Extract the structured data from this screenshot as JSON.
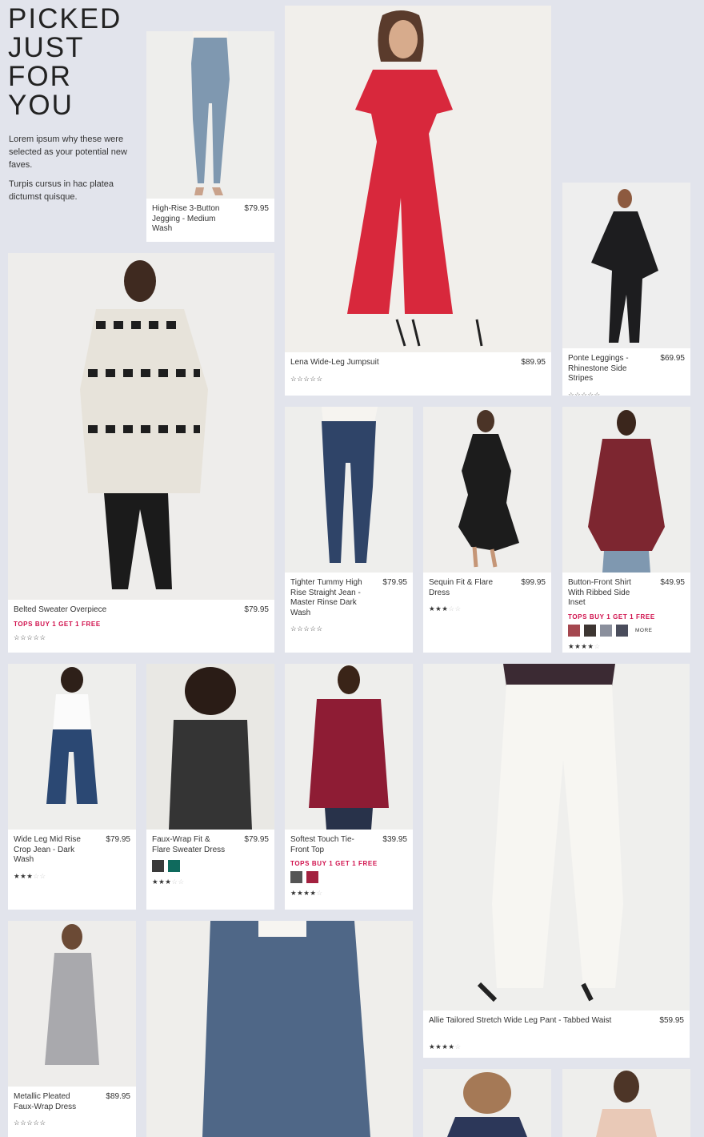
{
  "hero": {
    "title": "PICKED JUST FOR YOU",
    "intro1": "Lorem ipsum why these were selected as your potential new faves.",
    "intro2": "Turpis cursus in hac platea dictumst quisque."
  },
  "products": [
    {
      "name": "High-Rise 3-Button Jegging - Medium Wash",
      "price": "$79.95",
      "stars": 0,
      "promo": "",
      "swatches": []
    },
    {
      "name": "Lena Wide-Leg Jumpsuit",
      "price": "$89.95",
      "stars": 0,
      "promo": "",
      "swatches": []
    },
    {
      "name": "Ponte Leggings - Rhinestone Side Stripes",
      "price": "$69.95",
      "stars": 0,
      "promo": "",
      "swatches": []
    },
    {
      "name": "Belted Sweater Overpiece",
      "price": "$79.95",
      "stars": 0,
      "promo": "TOPS BUY 1 GET 1 FREE",
      "swatches": []
    },
    {
      "name": "Tighter Tummy High Rise Straight Jean - Master Rinse Dark Wash",
      "price": "$79.95",
      "stars": 0,
      "promo": "",
      "swatches": []
    },
    {
      "name": "Sequin Fit & Flare Dress",
      "price": "$99.95",
      "stars": 3,
      "promo": "",
      "swatches": []
    },
    {
      "name": "Button-Front Shirt With Ribbed Side Inset",
      "price": "$49.95",
      "stars": 4,
      "promo": "TOPS BUY 1 GET 1 FREE",
      "swatches": [
        "#a4474f",
        "#3d3632",
        "#8a8f9c",
        "#4a4d5c"
      ],
      "more": "MORE"
    },
    {
      "name": "Wide Leg Mid Rise Crop Jean - Dark Wash",
      "price": "$79.95",
      "stars": 3,
      "promo": "",
      "swatches": []
    },
    {
      "name": "Faux-Wrap Fit & Flare Sweater Dress",
      "price": "$79.95",
      "stars": 3,
      "promo": "",
      "swatches": [
        "#3a3a3a",
        "#0f6a5d"
      ]
    },
    {
      "name": "Softest Touch Tie-Front Top",
      "price": "$39.95",
      "stars": 4,
      "promo": "TOPS BUY 1 GET 1 FREE",
      "swatches": [
        "#555555",
        "#a3213f"
      ]
    },
    {
      "name": "Allie Tailored Stretch Wide Leg Pant - Tabbed Waist",
      "price": "$59.95",
      "stars": 4,
      "promo": "",
      "swatches": []
    },
    {
      "name": "Metallic Pleated Faux-Wrap Dress",
      "price": "$89.95",
      "stars": 0,
      "promo": "",
      "swatches": []
    },
    {
      "name": "",
      "price": "",
      "stars": 0,
      "promo": "",
      "swatches": []
    },
    {
      "name": "",
      "price": "",
      "stars": 0,
      "promo": "",
      "swatches": []
    },
    {
      "name": "",
      "price": "",
      "stars": 0,
      "promo": "",
      "swatches": []
    }
  ],
  "icons": {
    "rating": "star-icon",
    "star_glyph": "☆",
    "star_filled_glyph": "★"
  },
  "colors": {
    "background": "#e2e4ec",
    "promo": "#d0104c"
  }
}
